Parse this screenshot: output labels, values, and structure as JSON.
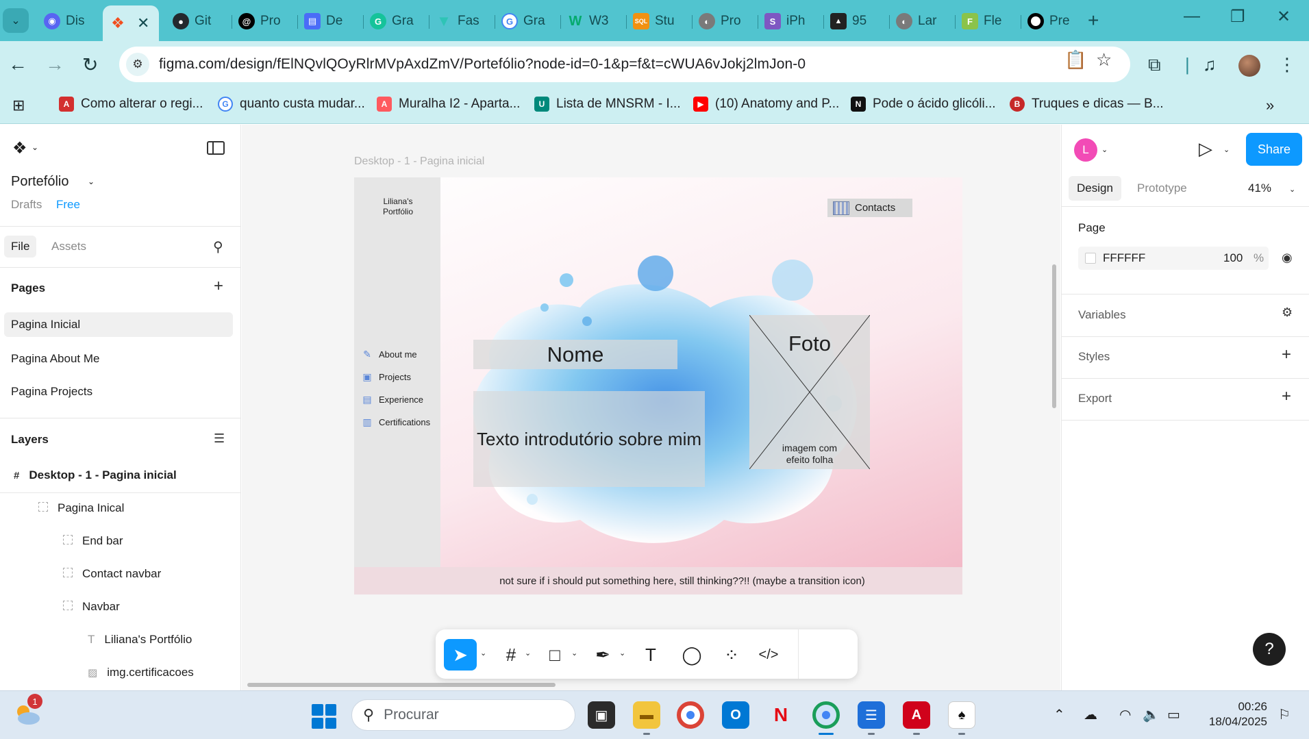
{
  "browser": {
    "tabs": [
      {
        "label": "Dis",
        "icon": "discord-icon",
        "color": "#5865F2",
        "glyph": "D"
      },
      {
        "label": "",
        "icon": "figma-icon",
        "color": "#F24E1E",
        "glyph": "F",
        "active": true
      },
      {
        "label": "Git",
        "icon": "github-icon",
        "color": "#24292e",
        "glyph": "G"
      },
      {
        "label": "Pro",
        "icon": "threads-icon",
        "color": "#000000",
        "glyph": "@"
      },
      {
        "label": "De",
        "icon": "docs-icon",
        "color": "#4A6CF7",
        "glyph": "D"
      },
      {
        "label": "Gra",
        "icon": "grammarly-icon",
        "color": "#15C39A",
        "glyph": "G"
      },
      {
        "label": "Fas",
        "icon": "vercel-icon",
        "color": "#2ec4b6",
        "glyph": "V"
      },
      {
        "label": "Gra",
        "icon": "google-icon",
        "color": "#4285F4",
        "glyph": "G"
      },
      {
        "label": "W3",
        "icon": "w3schools-icon",
        "color": "#04AA6D",
        "glyph": "W"
      },
      {
        "label": "Stu",
        "icon": "mysql-icon",
        "color": "#F29111",
        "glyph": "S"
      },
      {
        "label": "Pro",
        "icon": "globe-icon",
        "color": "#7a7a7a",
        "glyph": "◐"
      },
      {
        "label": "iPh",
        "icon": "s-icon",
        "color": "#7e57c2",
        "glyph": "S"
      },
      {
        "label": "95",
        "icon": "cursor-icon",
        "color": "#222222",
        "glyph": "▲"
      },
      {
        "label": "Lar",
        "icon": "globe-icon",
        "color": "#7a7a7a",
        "glyph": "◐"
      },
      {
        "label": "Fle",
        "icon": "frog-icon",
        "color": "#8BC34A",
        "glyph": "F"
      },
      {
        "label": "Pre",
        "icon": "circle-icon",
        "color": "#000000",
        "glyph": "●"
      }
    ],
    "url": "figma.com/design/fElNQvlQOyRlrMVpAxdZmV/Portefólio?node-id=0-1&p=f&t=cWUA6vJokj2lmJon-0",
    "bookmarks": [
      {
        "label": "Como alterar o regi...",
        "icon": "acp-icon",
        "color": "#d32f2f",
        "glyph": "A"
      },
      {
        "label": "quanto custa mudar...",
        "icon": "google-icon",
        "color": "#4285F4",
        "glyph": "G"
      },
      {
        "label": "Muralha I2 - Aparta...",
        "icon": "airbnb-icon",
        "color": "#FF5A5F",
        "glyph": "A"
      },
      {
        "label": "Lista de MNSRM - I...",
        "icon": "infarmed-icon",
        "color": "#00897b",
        "glyph": "U"
      },
      {
        "label": "(10) Anatomy and P...",
        "icon": "youtube-icon",
        "color": "#FF0000",
        "glyph": "▶"
      },
      {
        "label": "Pode o ácido glicóli...",
        "icon": "notion-icon",
        "color": "#111111",
        "glyph": "N"
      },
      {
        "label": "Truques e dicas — B...",
        "icon": "bf-icon",
        "color": "#c62828",
        "glyph": "B"
      }
    ]
  },
  "figma": {
    "file_title": "Portefólio",
    "drafts_label": "Drafts",
    "plan_label": "Free",
    "tab_file": "File",
    "tab_assets": "Assets",
    "pages_heading": "Pages",
    "pages": [
      "Pagina Inicial",
      "Pagina About Me",
      "Pagina Projects"
    ],
    "layers_heading": "Layers",
    "layers": [
      {
        "label": "Desktop - 1 - Pagina inicial",
        "type": "frame"
      },
      {
        "label": "Pagina Inical",
        "type": "group"
      },
      {
        "label": "End bar",
        "type": "group"
      },
      {
        "label": "Contact navbar",
        "type": "group"
      },
      {
        "label": "Navbar",
        "type": "group"
      },
      {
        "label": "Liliana's Portfólio",
        "type": "text"
      },
      {
        "label": "img.certificacoes",
        "type": "image"
      }
    ],
    "frame_label": "Desktop - 1 - Pagina inicial",
    "design": {
      "brand_line1": "Liliana's",
      "brand_line2": "Portfólio",
      "nav": [
        {
          "label": "About me",
          "icon": "pen-icon"
        },
        {
          "label": "Projects",
          "icon": "projects-icon"
        },
        {
          "label": "Experience",
          "icon": "experience-icon"
        },
        {
          "label": "Certifications",
          "icon": "certifications-icon"
        }
      ],
      "contacts": "Contacts",
      "nome": "Nome",
      "texto": "Texto introdutório sobre mim",
      "foto": "Foto",
      "foto_sub_line1": "imagem com",
      "foto_sub_line2": "efeito folha",
      "footer": "not sure if i should put something here, still thinking??!! (maybe a transition icon)"
    },
    "right": {
      "avatar_initial": "L",
      "share": "Share",
      "tab_design": "Design",
      "tab_prototype": "Prototype",
      "zoom": "41%",
      "page_heading": "Page",
      "page_fill_hex": "FFFFFF",
      "page_fill_opacity": "100",
      "page_fill_pct": "%",
      "variables": "Variables",
      "styles": "Styles",
      "export": "Export",
      "help": "?"
    }
  },
  "taskbar": {
    "weather_badge": "1",
    "search_placeholder": "Procurar",
    "time": "00:26",
    "date": "18/04/2025"
  },
  "colors": {
    "chrome_tabstrip": "#51c4cf",
    "chrome_toolbar": "#cdeff2",
    "figma_blue": "#0d99ff"
  }
}
